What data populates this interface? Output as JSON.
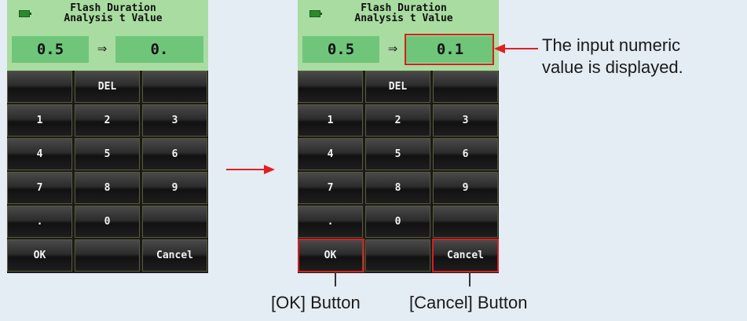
{
  "screen_before": {
    "title_line1": "Flash Duration",
    "title_line2": "Analysis t Value",
    "value_from": "0.5",
    "arrow": "⇒",
    "value_to": "0.",
    "keys": [
      "",
      "DEL",
      "",
      "1",
      "2",
      "3",
      "4",
      "5",
      "6",
      "7",
      "8",
      "9",
      ".",
      "0",
      "",
      "OK",
      "",
      "Cancel"
    ]
  },
  "screen_after": {
    "title_line1": "Flash Duration",
    "title_line2": "Analysis t Value",
    "value_from": "0.5",
    "arrow": "⇒",
    "value_to": "0.1",
    "keys": [
      "",
      "DEL",
      "",
      "1",
      "2",
      "3",
      "4",
      "5",
      "6",
      "7",
      "8",
      "9",
      ".",
      "0",
      "",
      "OK",
      "",
      "Cancel"
    ]
  },
  "annotations": {
    "value_line1": "The input numeric",
    "value_line2": "value is displayed.",
    "ok_label": "[OK] Button",
    "cancel_label": "[Cancel] Button"
  },
  "colors": {
    "header_bg": "#a9dca0",
    "value_box": "#6fc67a",
    "highlight": "#d42020",
    "background": "#e4ecf4"
  },
  "icons": [
    "battery-icon",
    "right-arrow-icon"
  ]
}
